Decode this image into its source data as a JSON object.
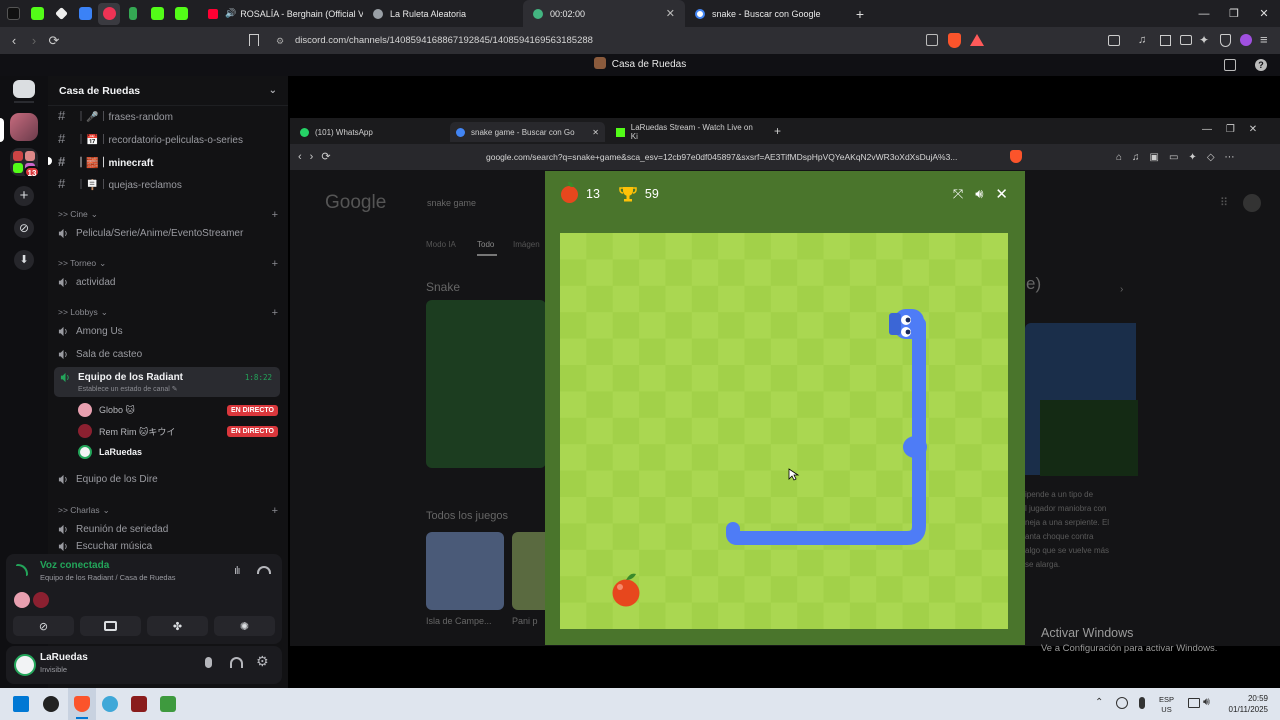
{
  "browser": {
    "tabs": [
      {
        "label": "ROSALÍA - Berghain (Official Vide",
        "color": "#ff0033"
      },
      {
        "label": "La Ruleta Aleatoria",
        "color": "#9aa0a6"
      },
      {
        "label": "00:02:00",
        "color": "#43b581"
      },
      {
        "label": "snake - Buscar con Google",
        "color": "#4285f4"
      }
    ],
    "new_tab": "+",
    "url": "discord.com/channels/1408594168867192845/1408594169563185288"
  },
  "discord": {
    "title": "Casa de Ruedas",
    "server_name": "Casa de Ruedas",
    "rail_badge": "13",
    "channels_top": [
      {
        "name": "｜🎤｜frases-random"
      },
      {
        "name": "｜📅｜recordatorio-peliculas-o-series"
      },
      {
        "name": "｜🧱｜minecraft"
      },
      {
        "name": "｜🪧｜quejas-reclamos"
      }
    ],
    "categories": {
      "cine": ">> Cine",
      "torneo": ">> Torneo",
      "lobbys": ">> Lobbys",
      "charlas": ">> Charlas"
    },
    "voice_channels": {
      "cine_1": "Pelicula/Serie/Anime/EventoStreamer",
      "torneo_1": "actividad",
      "lobbys_1": "Among Us",
      "lobbys_2": "Sala de casteo",
      "lobbys_3": "Equipo de los Radiant",
      "lobbys_3_timer": "1:8:22",
      "lobbys_3_status": "Establece un estado de canal",
      "lobbys_4": "Equipo de los Dire",
      "charlas_1": "Reunión de seriedad",
      "charlas_2": "Escuchar música"
    },
    "members": [
      {
        "name": "Globo 🐱",
        "live": "EN DIRECTO"
      },
      {
        "name": "Rem Rim 🐱キウイ",
        "live": "EN DIRECTO"
      },
      {
        "name": "LaRuedas",
        "live": ""
      }
    ],
    "voice_panel": {
      "status": "Voz conectada",
      "location": "Equipo de los Radiant / Casa de Ruedas"
    },
    "user": {
      "name": "LaRuedas",
      "status": "Invisible"
    }
  },
  "stream": {
    "tabs": [
      {
        "label": "(101) WhatsApp"
      },
      {
        "label": "snake game - Buscar con Go"
      },
      {
        "label": "LaRuedas Stream - Watch Live on Ki"
      }
    ],
    "url": "google.com/search?q=snake+game&sca_esv=12cb97e0df045897&sxsrf=AE3TifMDspHpVQYeAKqN2vWR3oXdXsDujA%3...",
    "google_query": "snake game",
    "google_tabs": [
      "Modo IA",
      "Todo",
      "Imágen"
    ],
    "section_snake": "Snake",
    "section_games": "Todos los juegos",
    "game_captions": [
      "Isla de Campe...",
      "Pani p"
    ],
    "kp_paren": "e)",
    "kp_text": [
      "ipende a un tipo de",
      "l jugador maniobra con",
      "neja a una serpiente. El",
      "anta choque contra",
      "algo que se vuelve más",
      "se alarga."
    ]
  },
  "snake_game": {
    "apples": 13,
    "best": 59,
    "colors": {
      "board_light": "#aad751",
      "board_dark": "#a2d149",
      "frame": "#4a752c",
      "snake": "#4e7cf6",
      "apple": "#e7471d"
    }
  },
  "windows": {
    "activate_title": "Activar Windows",
    "activate_sub": "Ve a Configuración para activar Windows.",
    "lang": "ESP",
    "region": "US",
    "time": "20:59",
    "date": "01/11/2025"
  }
}
